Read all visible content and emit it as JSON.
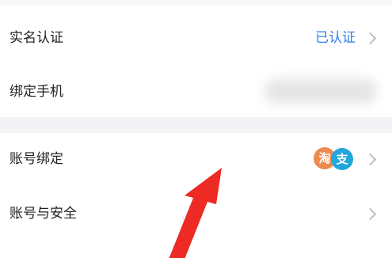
{
  "settings": {
    "rows": [
      {
        "label": "实名认证",
        "value": "已认证"
      },
      {
        "label": "绑定手机"
      },
      {
        "label": "账号绑定",
        "badges": [
          "淘",
          "支"
        ]
      },
      {
        "label": "账号与安全"
      }
    ]
  },
  "colors": {
    "status_blue": "#2c7ff0",
    "taobao_orange": "#ec8a4f",
    "alipay_blue": "#22a6dc",
    "annotation_red": "#ee2a24"
  },
  "icons": [
    "chevron-right-icon",
    "taobao-icon",
    "alipay-icon",
    "red-arrow-annotation"
  ]
}
